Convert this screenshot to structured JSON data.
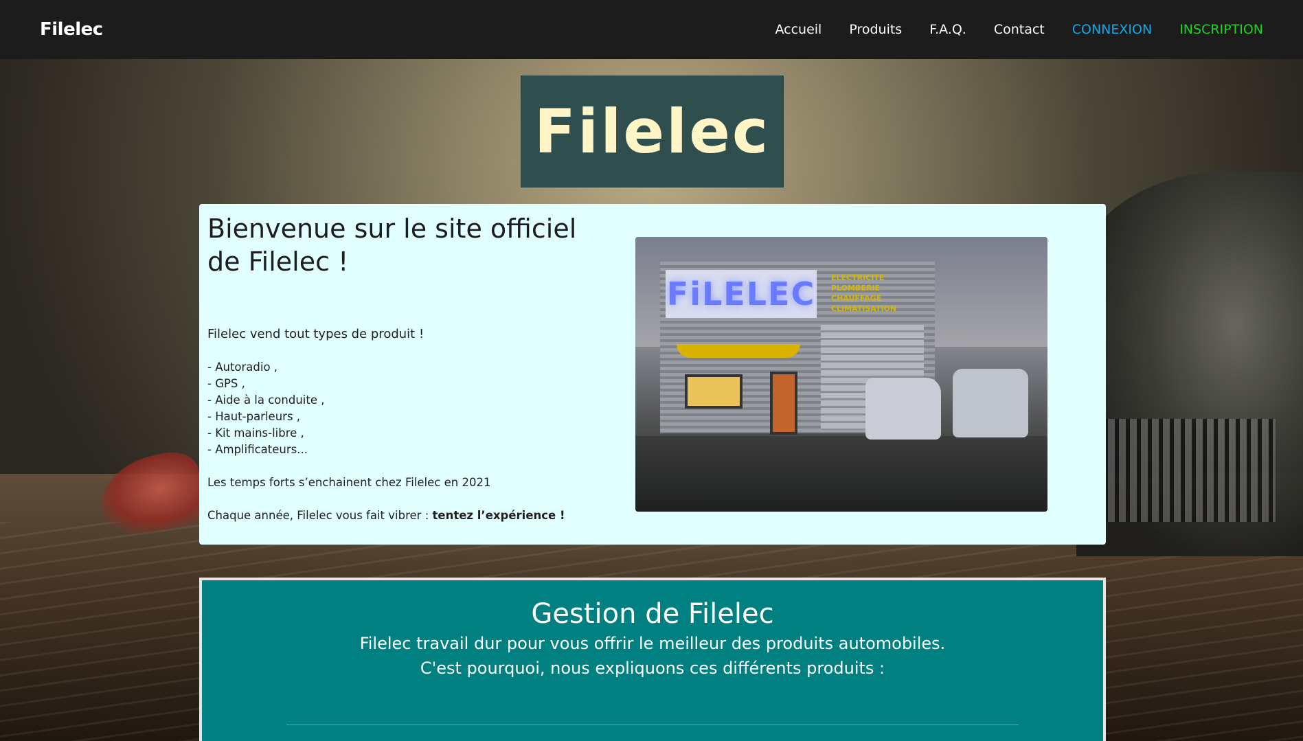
{
  "navbar": {
    "brand": "Filelec",
    "links": [
      "Accueil",
      "Produits",
      "F.A.Q.",
      "Contact"
    ],
    "login": "CONNEXION",
    "signup": "INSCRIPTION"
  },
  "hero": {
    "title": "Filelec"
  },
  "welcome": {
    "heading_line1": "Bienvenue sur le site officiel",
    "heading_line2": "de Filelec !",
    "lead": "Filelec vend tout types de produit !",
    "products": [
      "- Autoradio ,",
      "- GPS ,",
      "- Aide à la conduite ,",
      "- Haut-parleurs ,",
      "- Kit mains-libre ,",
      "- Amplificateurs..."
    ],
    "highlights": "Les temps forts s’enchainent chez Filelec en 2021",
    "tagline_prefix": "Chaque année, Filelec vous fait vibrer : ",
    "tagline_bold": "tentez l’expérience !",
    "photo": {
      "sign": "FiLELEC",
      "services": [
        "ELECTRICITE",
        "PLOMBERIE",
        "CHAUFFAGE",
        "CLIMATISATION"
      ]
    }
  },
  "gestion": {
    "title": "Gestion de Filelec",
    "line1": "Filelec travail dur pour vous offrir le meilleur des produits automobiles.",
    "line2": "C'est pourquoi, nous expliquons ces différents produits :"
  },
  "colors": {
    "navbar_bg": "#1c1c1c",
    "login": "#1ba8e6",
    "signup": "#1fd31f",
    "title_badge_bg": "#2f4f4f",
    "title_text": "#fff5c6",
    "welcome_bg": "#e1ffff",
    "gestion_bg": "#008080"
  }
}
